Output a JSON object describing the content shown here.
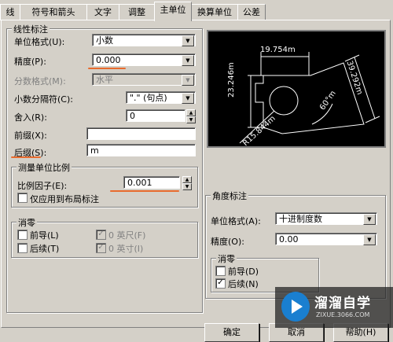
{
  "tabs": [
    "线",
    "符号和箭头",
    "文字",
    "调整",
    "主单位",
    "换算单位",
    "公差"
  ],
  "linear": {
    "title": "线性标注",
    "unit_format_label": "单位格式(U):",
    "unit_format_value": "小数",
    "precision_label": "精度(P):",
    "precision_value": "0.000",
    "fraction_label": "分数格式(M):",
    "fraction_value": "水平",
    "decimal_sep_label": "小数分隔符(C):",
    "decimal_sep_value": "\".\" (句点)",
    "round_label": "舍入(R):",
    "round_value": "0",
    "prefix_label": "前缀(X):",
    "prefix_value": "",
    "suffix_label": "后缀(S):",
    "suffix_value": "m"
  },
  "scale": {
    "title": "测量单位比例",
    "factor_label": "比例因子(E):",
    "factor_value": "0.001",
    "layout_only_label": "仅应用到布局标注"
  },
  "zero_linear": {
    "title": "消零",
    "leading_label": "前导(L)",
    "trailing_label": "后续(T)",
    "feet_label": "0 英尺(F)",
    "inches_label": "0 英寸(I)"
  },
  "angular": {
    "title": "角度标注",
    "unit_format_label": "单位格式(A):",
    "unit_format_value": "十进制度数",
    "precision_label": "精度(O):",
    "precision_value": "0.00",
    "zero_title": "消零",
    "leading_label": "前导(D)",
    "trailing_label": "后续(N)",
    "trailing_checked": true
  },
  "preview": {
    "dim_top": "19.754m",
    "dim_left": "23.246m",
    "dim_right": "39.292m",
    "dim_angle": "60°m",
    "dim_radius": "R15.844m"
  },
  "buttons": {
    "ok": "确定",
    "cancel": "取消",
    "help": "帮助(H)"
  },
  "watermark": {
    "cn": "溜溜自学",
    "en": "ZIXUE.3066.COM"
  },
  "colors": {
    "dialog_bg": "#d4d0c8",
    "preview_bg": "#000000",
    "annotation_red": "#e86b2e"
  }
}
